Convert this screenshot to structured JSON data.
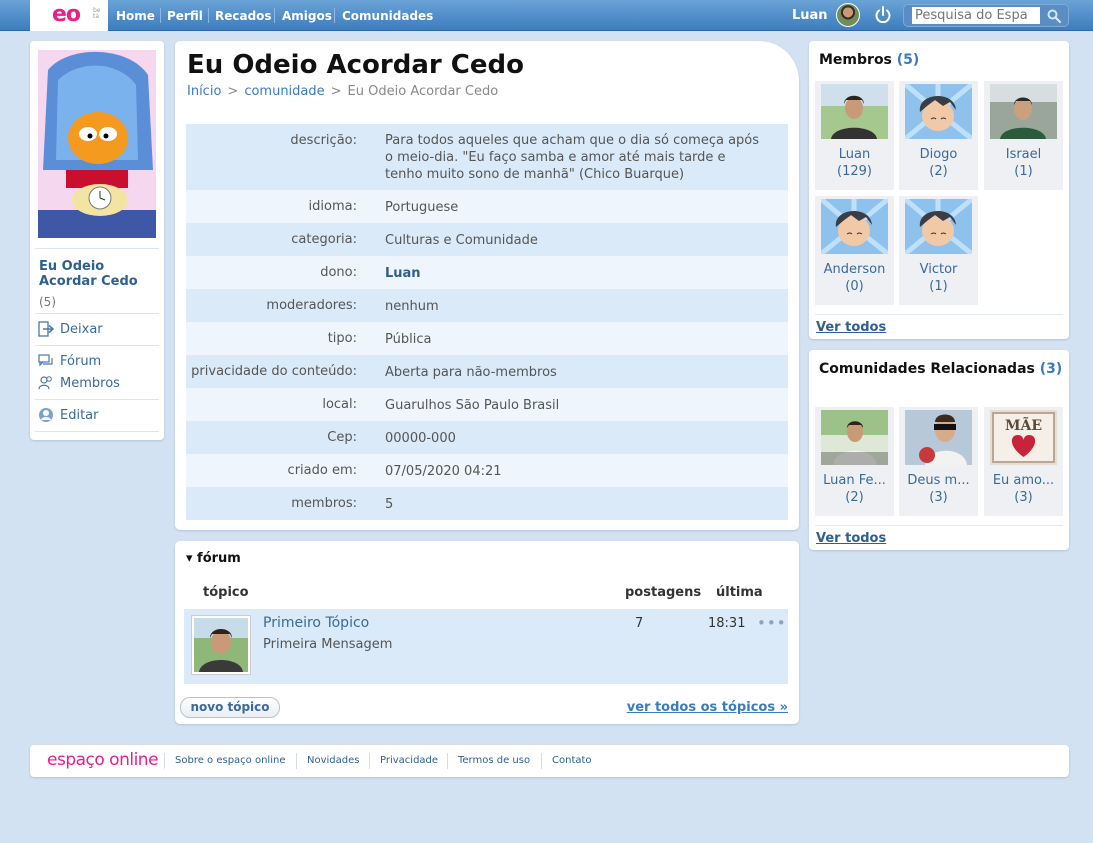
{
  "topbar": {
    "logo": "eo",
    "logo_small": "be ta",
    "nav": [
      "Home",
      "Perfil",
      "Recados",
      "Amigos",
      "Comunidades"
    ],
    "user_name": "Luan",
    "search_placeholder": "Pesquisa do Espa"
  },
  "sidebar": {
    "title": "Eu Odeio Acordar Cedo",
    "count": "(5)",
    "links": {
      "leave": "Deixar",
      "forum": "Fórum",
      "members": "Membros",
      "edit": "Editar"
    }
  },
  "main": {
    "title": "Eu Odeio Acordar Cedo",
    "breadcrumb": [
      "Início",
      "comunidade",
      "Eu Odeio Acordar Cedo"
    ],
    "info": [
      {
        "key": "descrição:",
        "value": "Para todos aqueles que acham que o dia só começa após o meio-dia. \"Eu faço samba e amor até mais tarde e tenho muito sono de manhã\" (Chico Buarque)"
      },
      {
        "key": "idioma:",
        "value": "Portuguese"
      },
      {
        "key": "categoria:",
        "value": "Culturas e Comunidade"
      },
      {
        "key": "dono:",
        "value": "Luan"
      },
      {
        "key": "moderadores:",
        "value": "nenhum"
      },
      {
        "key": "tipo:",
        "value": "Pública"
      },
      {
        "key": "privacidade do conteúdo:",
        "value": "Aberta para não-membros"
      },
      {
        "key": "local:",
        "value": "Guarulhos São Paulo Brasil"
      },
      {
        "key": "Cep:",
        "value": "00000-000"
      },
      {
        "key": "criado em:",
        "value": "07/05/2020 04:21"
      },
      {
        "key": "membros:",
        "value": "5"
      }
    ]
  },
  "forum": {
    "heading": "▾ fórum",
    "columns": {
      "topic": "tópico",
      "posts": "postagens",
      "last": "última"
    },
    "topics": [
      {
        "title": "Primeiro Tópico",
        "subtitle": "Primeira Mensagem",
        "posts": "7",
        "last": "18:31",
        "more": "•••"
      }
    ],
    "new_topic": "novo tópico",
    "see_all": "ver todos os tópicos »"
  },
  "members": {
    "title": "Membros",
    "count": "(5)",
    "items": [
      {
        "name": "Luan",
        "count": "(129)"
      },
      {
        "name": "Diogo",
        "count": "(2)"
      },
      {
        "name": "Israel",
        "count": "(1)"
      },
      {
        "name": "Anderson",
        "count": "(0)"
      },
      {
        "name": "Victor",
        "count": "(1)"
      }
    ],
    "see_all": "Ver todos"
  },
  "related": {
    "title": "Comunidades Relacionadas",
    "count": "(3)",
    "items": [
      {
        "name": "Luan Fe...",
        "count": "(2)"
      },
      {
        "name": "Deus m...",
        "count": "(3)"
      },
      {
        "name": "Eu amo...",
        "count": "(3)",
        "image_text": "MÃE"
      }
    ],
    "see_all": "Ver todos"
  },
  "footer": {
    "logo": "espaço online",
    "links": [
      "Sobre o espaço online",
      "Novidades",
      "Privacidade",
      "Termos de uso",
      "Contato"
    ]
  },
  "colors": {
    "topbar": "#3d7cbf",
    "brand_pink": "#e81e8c",
    "link": "#2f5f8f",
    "row_alt": "#dbeaf8",
    "background": "#d3e2f3"
  }
}
